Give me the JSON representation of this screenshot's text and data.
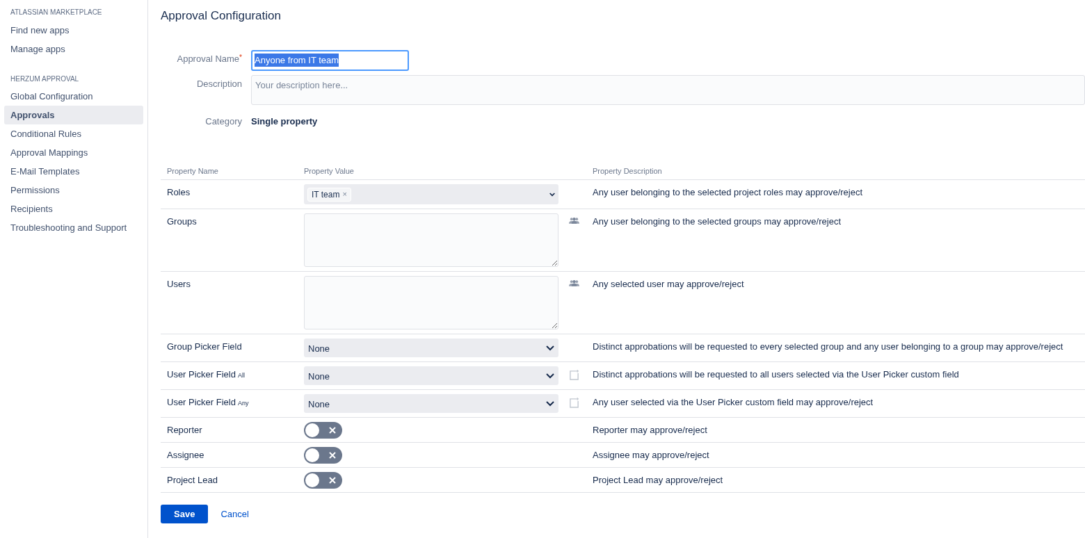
{
  "sidebar": {
    "sections": [
      {
        "heading": "ATLASSIAN MARKETPLACE",
        "items": [
          {
            "label": "Find new apps",
            "selected": false
          },
          {
            "label": "Manage apps",
            "selected": false
          }
        ]
      },
      {
        "heading": "HERZUM APPROVAL",
        "items": [
          {
            "label": "Global Configuration",
            "selected": false
          },
          {
            "label": "Approvals",
            "selected": true
          },
          {
            "label": "Conditional Rules",
            "selected": false
          },
          {
            "label": "Approval Mappings",
            "selected": false
          },
          {
            "label": "E-Mail Templates",
            "selected": false
          },
          {
            "label": "Permissions",
            "selected": false
          },
          {
            "label": "Recipients",
            "selected": false
          },
          {
            "label": "Troubleshooting and Support",
            "selected": false
          }
        ]
      }
    ]
  },
  "page_title": "Approval Configuration",
  "form": {
    "name": {
      "label": "Approval Name",
      "required_mark": "*",
      "value": "Anyone from IT team",
      "text_selected": true
    },
    "description": {
      "label": "Description",
      "placeholder": "Your description here..."
    },
    "category": {
      "label": "Category",
      "value": "Single property"
    }
  },
  "table": {
    "columns": [
      "Property Name",
      "Property Value",
      "Property Description"
    ],
    "rows": [
      {
        "name": "Roles",
        "kind": "multiselect",
        "tags": [
          "IT team"
        ],
        "remove": "×",
        "description": "Any user belonging to the selected project roles may approve/reject"
      },
      {
        "name": "Groups",
        "kind": "textarea",
        "description": "Any user belonging to the selected groups may approve/reject"
      },
      {
        "name": "Users",
        "kind": "textarea",
        "description": "Any selected user may approve/reject"
      },
      {
        "name": "Group Picker Field",
        "kind": "select",
        "value": "None",
        "description": "Distinct approbations will be requested to every selected group and any user belonging to a group may approve/reject"
      },
      {
        "name": "User Picker Field",
        "qualifier": "All",
        "kind": "select",
        "value": "None",
        "description": "Distinct approbations will be requested to all users selected via the User Picker custom field"
      },
      {
        "name": "User Picker Field",
        "qualifier": "Any",
        "kind": "select",
        "value": "None",
        "description": "Any user selected via the User Picker custom field may approve/reject"
      },
      {
        "name": "Reporter",
        "kind": "toggle",
        "on": false,
        "description": "Reporter may approve/reject"
      },
      {
        "name": "Assignee",
        "kind": "toggle",
        "on": false,
        "description": "Assignee may approve/reject"
      },
      {
        "name": "Project Lead",
        "kind": "toggle",
        "on": false,
        "description": "Project Lead may approve/reject"
      }
    ]
  },
  "buttons": {
    "save": "Save",
    "cancel": "Cancel"
  }
}
